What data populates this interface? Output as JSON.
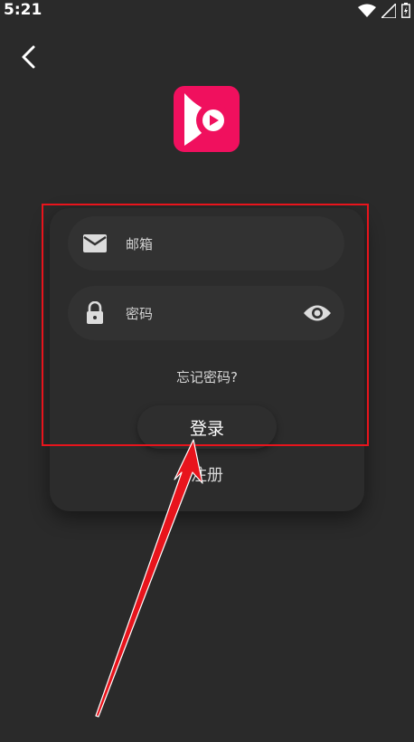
{
  "status_bar": {
    "time": "5:21"
  },
  "form": {
    "email_placeholder": "邮箱",
    "password_placeholder": "密码",
    "forgot_password": "忘记密码?",
    "login_label": "登录",
    "register_label": "注册"
  },
  "colors": {
    "background": "#2a2a2a",
    "logo_brand": "#f0105e",
    "highlight": "#e8141c"
  },
  "icons": [
    "back-arrow-icon",
    "app-logo-icon",
    "email-icon",
    "lock-icon",
    "eye-icon",
    "wifi-icon",
    "signal-icon",
    "battery-icon"
  ]
}
